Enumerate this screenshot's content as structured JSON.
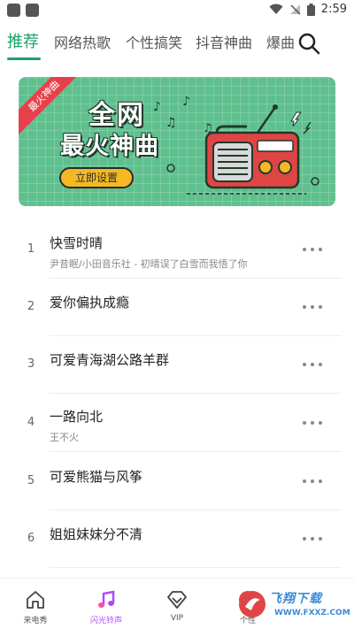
{
  "status_bar": {
    "time": "2:59"
  },
  "tabs": [
    {
      "label": "推荐",
      "active": true
    },
    {
      "label": "网络热歌",
      "active": false
    },
    {
      "label": "个性搞笑",
      "active": false
    },
    {
      "label": "抖音神曲",
      "active": false
    },
    {
      "label": "爆曲",
      "active": false
    }
  ],
  "banner": {
    "ribbon": "最火神曲",
    "title_line1": "全网",
    "title_line2": "最火神曲",
    "button_label": "立即设置"
  },
  "songs": [
    {
      "rank": "1",
      "title": "快雪时晴",
      "artist": "尹昔眠/小田音乐社 - 初晴误了白雪而我悟了你"
    },
    {
      "rank": "2",
      "title": "爱你偏执成瘾",
      "artist": ""
    },
    {
      "rank": "3",
      "title": "可爱青海湖公路羊群",
      "artist": ""
    },
    {
      "rank": "4",
      "title": "一路向北",
      "artist": "王不火"
    },
    {
      "rank": "5",
      "title": "可爱熊猫与风筝",
      "artist": ""
    },
    {
      "rank": "6",
      "title": "姐姐妹妹分不清",
      "artist": ""
    }
  ],
  "bottom_nav": [
    {
      "label": "来电秀",
      "icon": "home-icon"
    },
    {
      "label": "闪光铃声",
      "icon": "music-note-icon",
      "active": true
    },
    {
      "label": "VIP",
      "icon": "diamond-icon"
    },
    {
      "label": "个性",
      "icon": "user-icon"
    }
  ],
  "watermark": {
    "text": "飞翔下载",
    "url": "WWW.FXXZ.COM"
  },
  "colors": {
    "accent": "#1aa36a",
    "banner_bg": "#5fc08e",
    "nav_active": "#b04aff",
    "ribbon": "#e8404a"
  }
}
